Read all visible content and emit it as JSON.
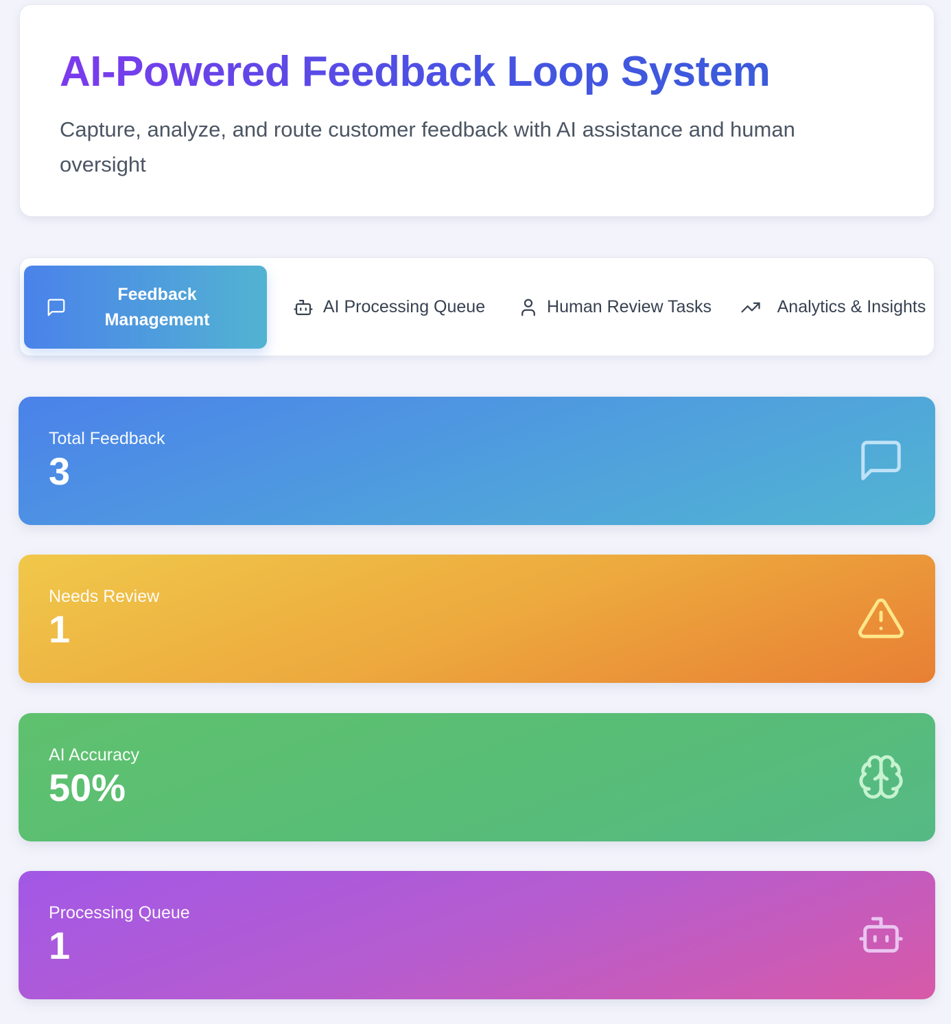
{
  "header": {
    "title": "AI-Powered Feedback Loop System",
    "subtitle": "Capture, analyze, and route customer feedback with AI assistance and human oversight"
  },
  "tabs": [
    {
      "label": "Feedback Management",
      "icon": "message-square-icon",
      "active": true
    },
    {
      "label": "AI Processing Queue",
      "icon": "bot-icon",
      "active": false
    },
    {
      "label": "Human Review Tasks",
      "icon": "user-icon",
      "active": false
    },
    {
      "label": "Analytics & Insights",
      "icon": "trending-up-icon",
      "active": false
    }
  ],
  "stats": [
    {
      "label": "Total Feedback",
      "value": "3",
      "icon": "message-square-icon",
      "color": "#4b82ea"
    },
    {
      "label": "Needs Review",
      "value": "1",
      "icon": "alert-triangle-icon",
      "color": "#edaa3e"
    },
    {
      "label": "AI Accuracy",
      "value": "50%",
      "icon": "brain-icon",
      "color": "#5fc16e"
    },
    {
      "label": "Processing Queue",
      "value": "1",
      "icon": "bot-icon",
      "color": "#b65ccf"
    }
  ],
  "colors": {
    "title_gradient_start": "#7c3aed",
    "title_gradient_end": "#3b5bdb",
    "background": "#f3f4fb"
  }
}
